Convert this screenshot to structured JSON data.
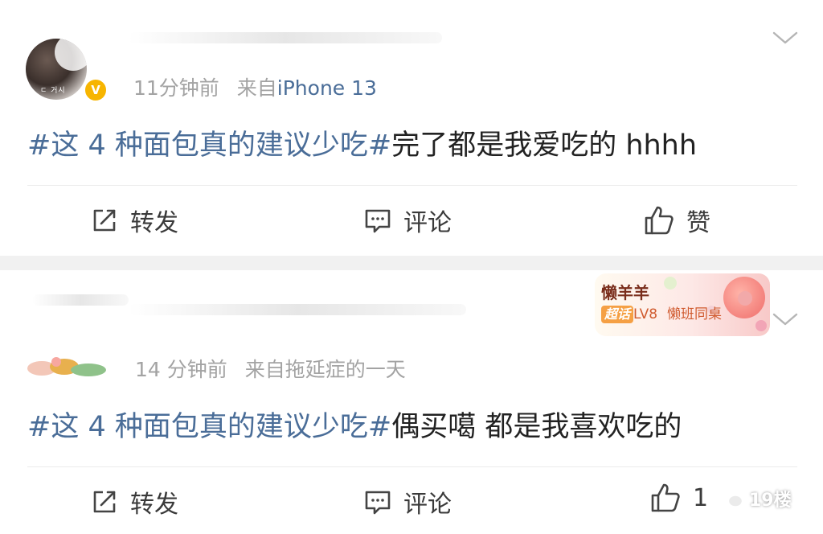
{
  "posts": [
    {
      "meta": {
        "time": "11分钟前",
        "source_prefix": "来自",
        "source": "iPhone 13",
        "avatar_caption": "ㄷ 거시"
      },
      "verified_badge": "V",
      "content": {
        "topic": "#这 4 种面包真的建议少吃#",
        "text": "完了都是我爱吃的 hhhh"
      },
      "actions": {
        "repost_label": "转发",
        "comment_label": "评论",
        "like_label": "赞"
      }
    },
    {
      "meta": {
        "time": "14 分钟前",
        "source_prefix": "来自",
        "source": "拖延症的一天"
      },
      "fan_badge": {
        "name": "懒羊羊",
        "tag": "超话",
        "level": "LV8",
        "group": "懒班同桌"
      },
      "content": {
        "topic": "#这 4 种面包真的建议少吃#",
        "text": "偶买噶 都是我喜欢吃的"
      },
      "actions": {
        "repost_label": "转发",
        "comment_label": "评论",
        "like_count": "1"
      }
    }
  ],
  "watermark": {
    "text": "19楼",
    "icon": "wechat-icon"
  },
  "colors": {
    "topic_link": "#4a6d98",
    "meta_gray": "#a3a3a3",
    "verified_gold": "#f7b500",
    "divider_band": "#f1f1f1"
  }
}
